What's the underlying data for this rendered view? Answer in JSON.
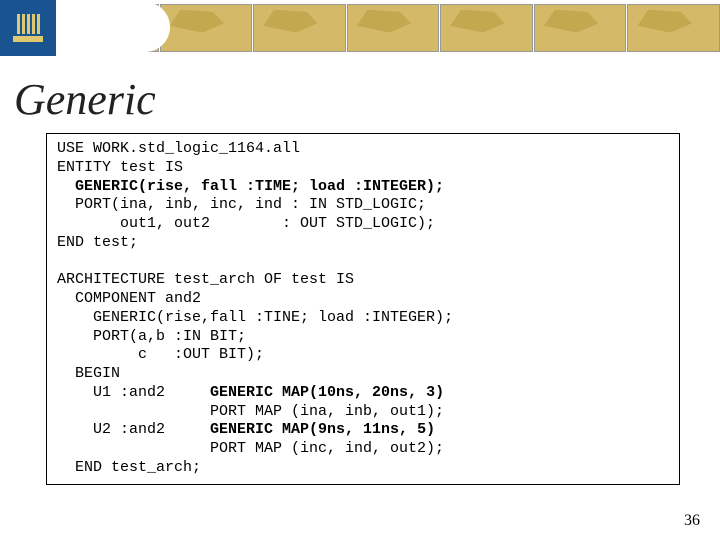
{
  "title": "Generic",
  "page_number": "36",
  "code": {
    "l1": "USE WORK.std_logic_1164.all",
    "l2": "ENTITY test IS",
    "l3a": "  GENERIC(rise, fall :TIME; load :INTEGER);",
    "l4": "  PORT(ina, inb, inc, ind : IN STD_LOGIC;",
    "l5": "       out1, out2        : OUT STD_LOGIC);",
    "l6": "END test;",
    "l7": "",
    "l8": "ARCHITECTURE test_arch OF test IS",
    "l9": "  COMPONENT and2",
    "l10": "    GENERIC(rise,fall :TINE; load :INTEGER);",
    "l11": "    PORT(a,b :IN BIT;",
    "l12": "         c   :OUT BIT);",
    "l13": "  BEGIN",
    "l14a": "    U1 :and2     ",
    "l14b": "GENERIC MAP(10ns, 20ns, 3)",
    "l15": "                 PORT MAP (ina, inb, out1);",
    "l16a": "    U2 :and2     ",
    "l16b": "GENERIC MAP(9ns, 11ns, 5)",
    "l17": "                 PORT MAP (inc, ind, out2);",
    "l18": "  END test_arch;"
  }
}
